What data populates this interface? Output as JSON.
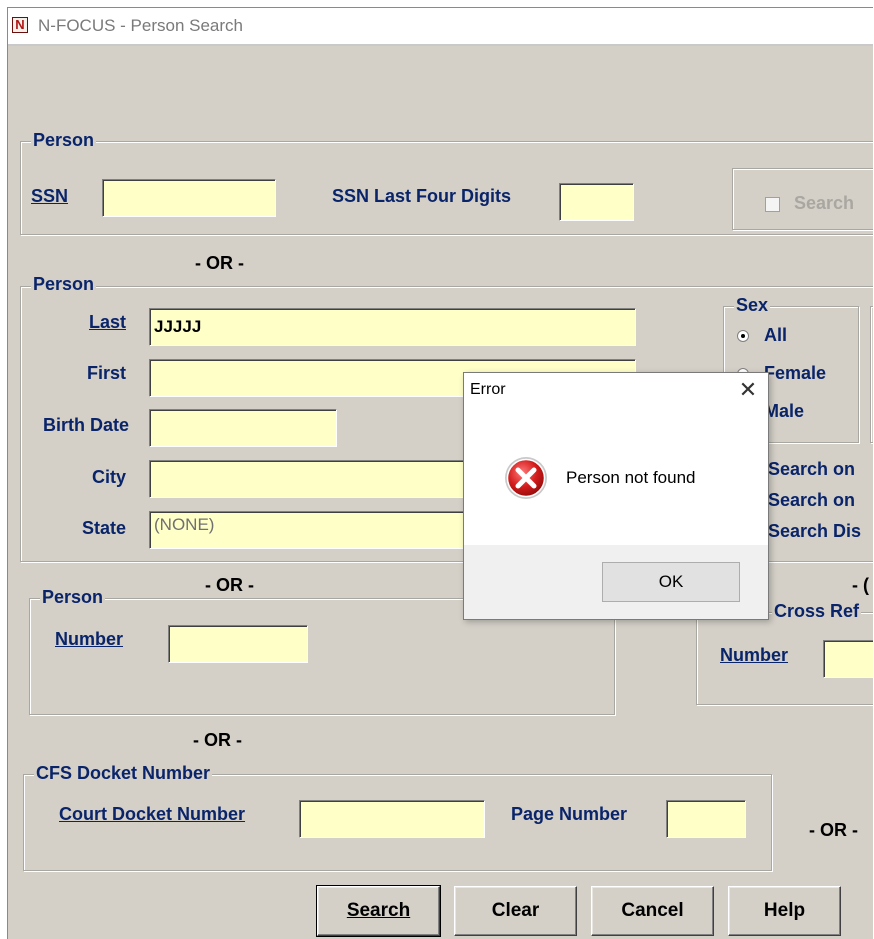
{
  "window": {
    "title": "N-FOCUS - Person Search",
    "icon": "N"
  },
  "person_ssn": {
    "legend": "Person",
    "ssn_label": "SSN",
    "ssn_value": "",
    "ssn_last4_label": "SSN Last Four Digits",
    "ssn_last4_value": "",
    "search_checkbox_label": "Search"
  },
  "or_labels": {
    "or1": "- OR -",
    "or2": "- OR -",
    "or3": "- OR -",
    "or4": "- OR -",
    "or5": "- OR -",
    "or6": "- ("
  },
  "person_name": {
    "legend": "Person",
    "last_label": "Last",
    "last_value": "JJJJJ",
    "first_label": "First",
    "first_value": "",
    "birth_label": "Birth Date",
    "birth_value": "",
    "city_label": "City",
    "city_value": "",
    "state_label": "State",
    "state_value": "(NONE)"
  },
  "sex": {
    "legend": "Sex",
    "options": [
      "All",
      "Female",
      "Male"
    ],
    "selected": "All"
  },
  "search_on": {
    "line1": "Search on",
    "line2": "Search on",
    "line3": "Search Dis"
  },
  "person_number": {
    "legend": "Person",
    "number_label": "Number",
    "number_value": ""
  },
  "cross_ref": {
    "legend": "Cross Ref",
    "number_label": "Number",
    "number_value": ""
  },
  "cfs": {
    "legend": "CFS Docket Number",
    "court_label": "Court Docket Number",
    "court_value": "",
    "page_label": "Page Number",
    "page_value": ""
  },
  "buttons": {
    "search": "Search",
    "clear": "Clear",
    "cancel": "Cancel",
    "help": "Help"
  },
  "error_dialog": {
    "title": "Error",
    "close": "✕",
    "message": "Person not found",
    "ok": "OK"
  }
}
